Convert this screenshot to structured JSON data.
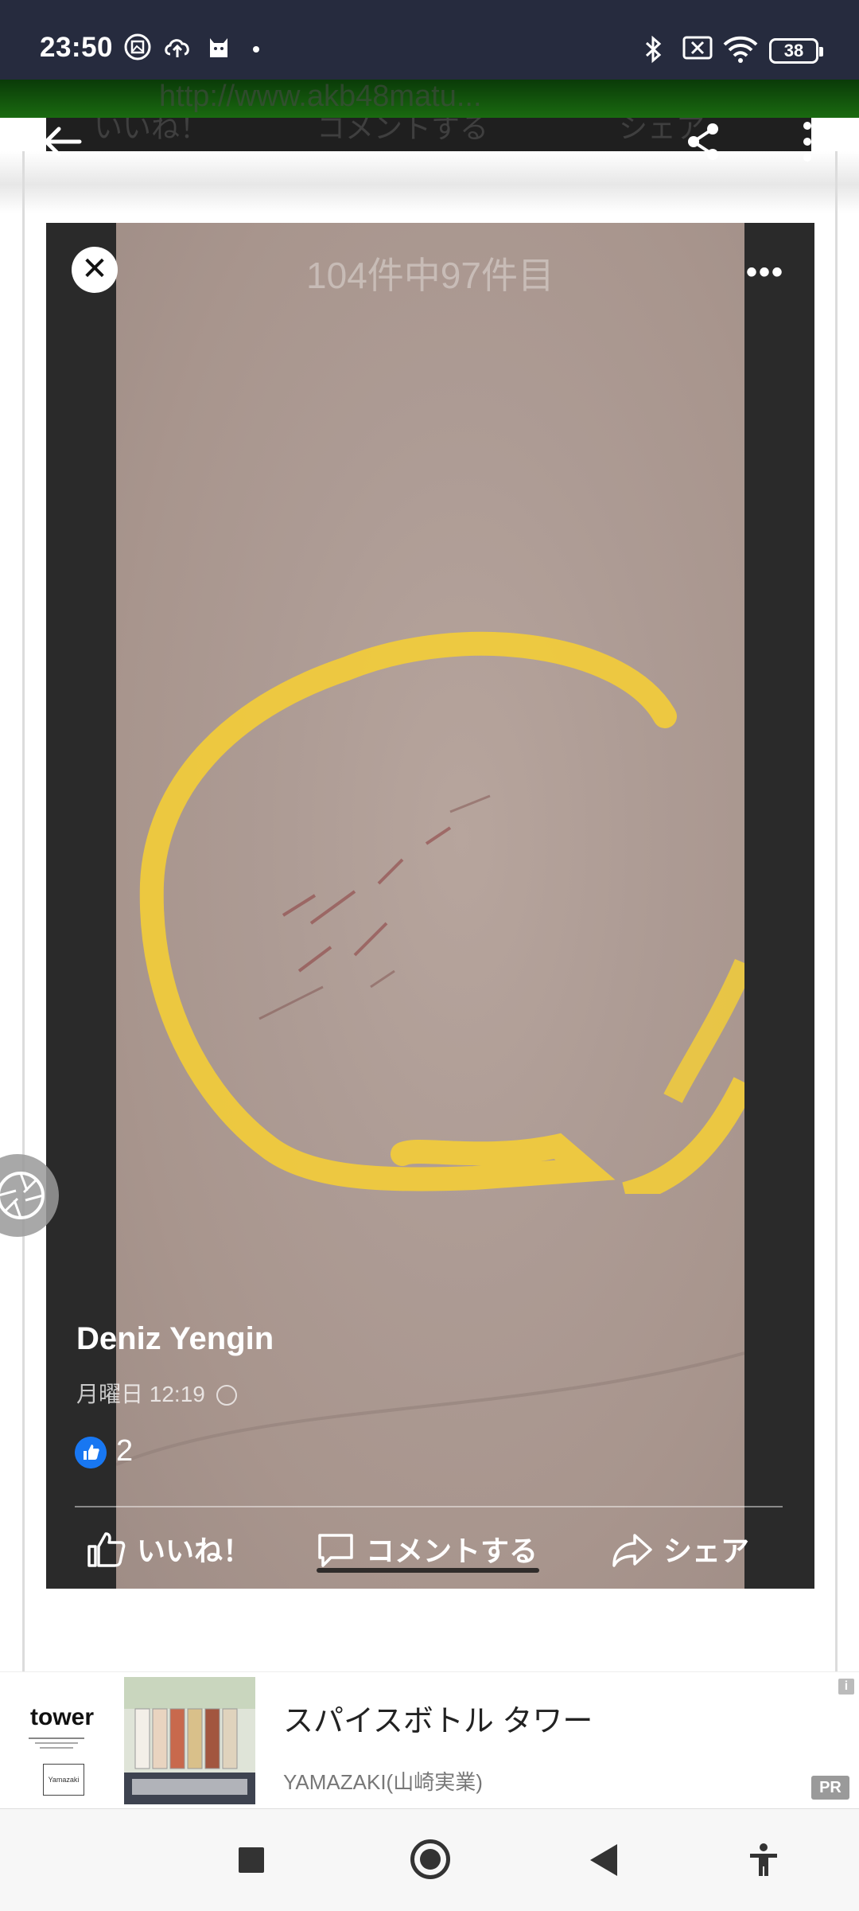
{
  "status_bar": {
    "time": "23:50",
    "battery": "38",
    "icons": [
      "photo-icon",
      "cloud-upload-icon",
      "cat-icon",
      "bluetooth-icon",
      "sim-off-icon",
      "wifi-icon",
      "battery-icon"
    ]
  },
  "background_url_text": "http://www.akb48matu...",
  "toolbar": {
    "back_icon": "back-arrow-icon",
    "share_icon": "share-icon",
    "more_icon": "more-vert-icon",
    "obscured_actions": [
      "いいね！",
      "コメントする",
      "シェア"
    ]
  },
  "embedded_post": {
    "counter": "104件中97件目",
    "poster_name": "Deniz Yengin",
    "post_time": "月曜日 12:19",
    "like_count": "2",
    "actions": {
      "like": "いいね！",
      "comment": "コメントする",
      "share": "シェア"
    }
  },
  "ad": {
    "logo_text": "tower",
    "logo_box_text": "Yamazaki",
    "title": "スパイスボトル タワー",
    "advertiser": "YAMAZAKI(山崎実業)",
    "pr_label": "PR",
    "info_label": "i"
  },
  "colors": {
    "status_bar_bg": "#262b3e",
    "highlight_yellow": "#f2cc3a",
    "facebook_blue": "#1877f2"
  }
}
